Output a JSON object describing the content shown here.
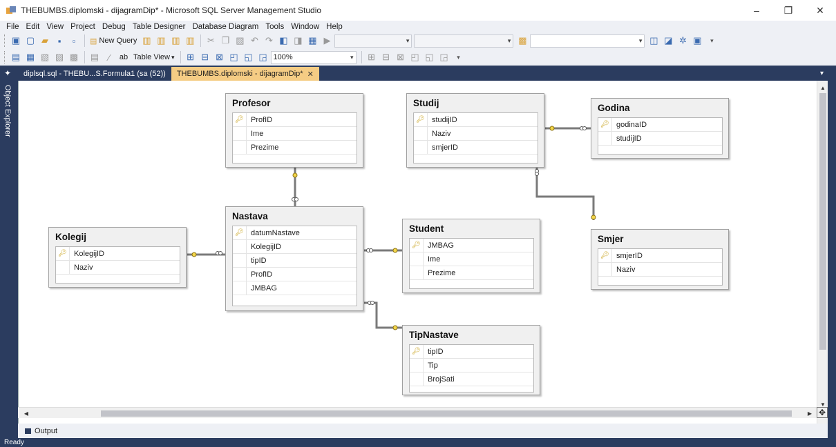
{
  "window": {
    "title": "THEBUMBS.diplomski - dijagramDip* - Microsoft SQL Server Management Studio",
    "minimize": "–",
    "maximize": "❐",
    "close": "✕"
  },
  "menu": [
    "File",
    "Edit",
    "View",
    "Project",
    "Debug",
    "Table Designer",
    "Database Diagram",
    "Tools",
    "Window",
    "Help"
  ],
  "toolbar": {
    "new_query": "New Query",
    "table_view": "Table View",
    "zoom": "100%"
  },
  "left_panel": {
    "object_explorer": "Object Explorer"
  },
  "tabs": [
    {
      "label": "diplsql.sql - THEBU...S.Formula1 (sa (52))",
      "active": false
    },
    {
      "label": "THEBUMBS.diplomski - dijagramDip*",
      "active": true
    }
  ],
  "tables": {
    "profesor": {
      "name": "Profesor",
      "pk": "ProfID",
      "columns": [
        "Ime",
        "Prezime"
      ]
    },
    "studij": {
      "name": "Studij",
      "pk": "studijID",
      "columns": [
        "Naziv",
        "smjerID"
      ]
    },
    "godina": {
      "name": "Godina",
      "pk": "godinaID",
      "columns": [
        "studijID"
      ]
    },
    "nastava": {
      "name": "Nastava",
      "pk": "datumNastave",
      "columns": [
        "KolegijID",
        "tipID",
        "ProfID",
        "JMBAG"
      ]
    },
    "kolegij": {
      "name": "Kolegij",
      "pk": "KolegijID",
      "columns": [
        "Naziv"
      ]
    },
    "student": {
      "name": "Student",
      "pk": "JMBAG",
      "columns": [
        "Ime",
        "Prezime"
      ]
    },
    "smjer": {
      "name": "Smjer",
      "pk": "smjerID",
      "columns": [
        "Naziv"
      ]
    },
    "tipnastave": {
      "name": "TipNastave",
      "pk": "tipID",
      "columns": [
        "Tip",
        "BrojSati"
      ]
    }
  },
  "output_tab": "Output",
  "status": "Ready",
  "colors": {
    "chrome_dark": "#2b3c5f",
    "active_tab": "#f5cc84",
    "key_gold": "#c9a21a"
  }
}
